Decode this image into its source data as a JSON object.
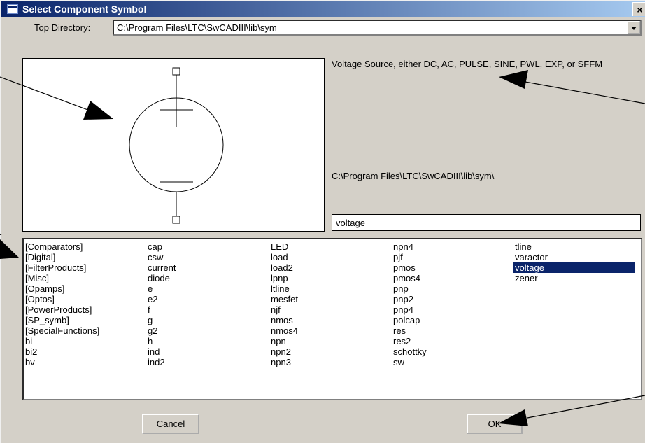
{
  "window": {
    "title": "Select Component Symbol",
    "close_glyph": "×"
  },
  "top_directory": {
    "label": "Top Directory:",
    "value": "C:\\Program Files\\LTC\\SwCADIII\\lib\\sym"
  },
  "symbol_description": "Voltage Source, either DC, AC, PULSE, SINE, PWL, EXP, or SFFM",
  "symbol_path": "C:\\Program Files\\LTC\\SwCADIII\\lib\\sym\\",
  "search": {
    "value": "voltage"
  },
  "component_columns": [
    [
      "[Comparators]",
      "[Digital]",
      "[FilterProducts]",
      "[Misc]",
      "[Opamps]",
      "[Optos]",
      "[PowerProducts]",
      "[SP_symb]",
      "[SpecialFunctions]",
      "bi",
      "bi2",
      "bv"
    ],
    [
      "cap",
      "csw",
      "current",
      "diode",
      "e",
      "e2",
      "f",
      "g",
      "g2",
      "h",
      "ind",
      "ind2"
    ],
    [
      "LED",
      "load",
      "load2",
      "lpnp",
      "ltline",
      "mesfet",
      "njf",
      "nmos",
      "nmos4",
      "npn",
      "npn2",
      "npn3"
    ],
    [
      "npn4",
      "pjf",
      "pmos",
      "pmos4",
      "pnp",
      "pnp2",
      "pnp4",
      "polcap",
      "res",
      "res2",
      "schottky",
      "sw"
    ],
    [
      "tline",
      "varactor",
      "voltage",
      "zener"
    ]
  ],
  "selected_component": "voltage",
  "buttons": {
    "cancel": "Cancel",
    "ok": "OK"
  },
  "icons": {
    "window": "window-icon",
    "close": "close-icon",
    "dropdown": "chevron-down-icon"
  }
}
